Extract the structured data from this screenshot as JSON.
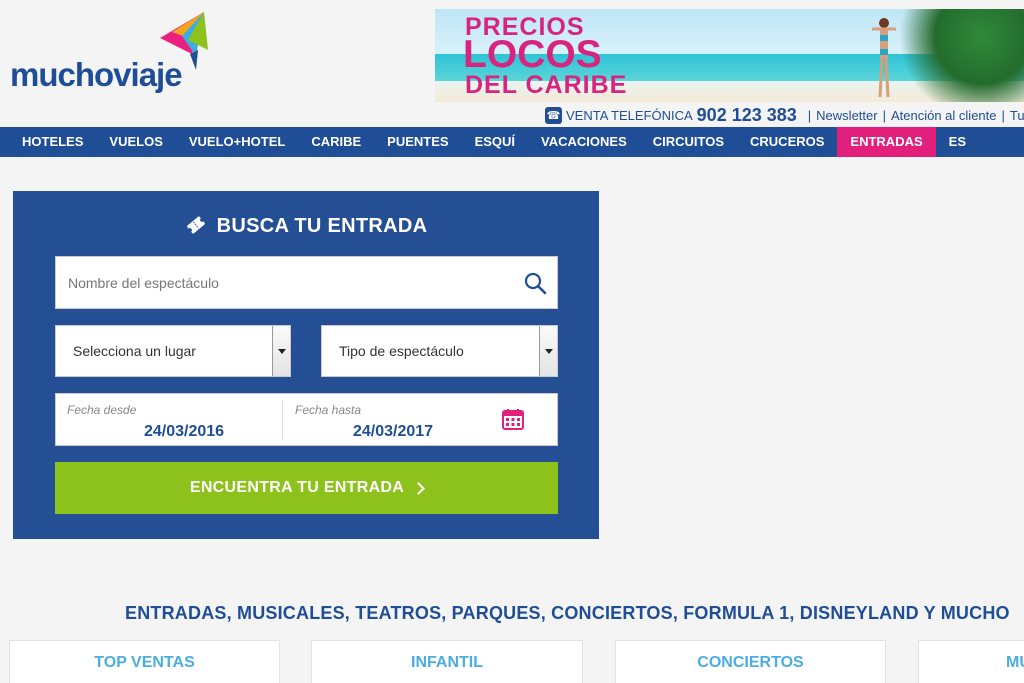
{
  "header": {
    "logo_text": "muchoviaje",
    "banner": {
      "line1": "PRECIOS",
      "line2": "LOCOS",
      "line3": "DEL CARIBE"
    },
    "contact": {
      "phone_icon": "phone-icon",
      "label": "VENTA TELEFÓNICA",
      "number": "902 123 383",
      "separator": "|",
      "links": [
        "Newsletter",
        "Atención al cliente",
        "Tus r"
      ]
    }
  },
  "nav": {
    "items": [
      {
        "label": "HOTELES"
      },
      {
        "label": "VUELOS"
      },
      {
        "label": "VUELO+HOTEL"
      },
      {
        "label": "CARIBE"
      },
      {
        "label": "PUENTES"
      },
      {
        "label": "ESQUÍ"
      },
      {
        "label": "VACACIONES"
      },
      {
        "label": "CIRCUITOS"
      },
      {
        "label": "CRUCEROS"
      },
      {
        "label": "ENTRADAS",
        "active": true
      },
      {
        "label": "ES"
      }
    ]
  },
  "search": {
    "title": "BUSCA TU ENTRADA",
    "show_placeholder": "Nombre del espectáculo",
    "place_select": "Selecciona un lugar",
    "type_select": "Tipo de espectáculo",
    "date_from_label": "Fecha desde",
    "date_from_value": "24/03/2016",
    "date_to_label": "Fecha hasta",
    "date_to_value": "24/03/2017",
    "submit_label": "ENCUENTRA TU ENTRADA"
  },
  "colors": {
    "brand_blue": "#1f4e96",
    "panel_blue": "#254f95",
    "active_pink": "#e2207c",
    "button_green": "#8cc21b",
    "card_title_blue": "#4aaee0"
  },
  "section": {
    "heading": "ENTRADAS, MUSICALES, TEATROS, PARQUES, CONCIERTOS, FORMULA 1, DISNEYLAND Y MUCHO"
  },
  "cards": [
    {
      "label": "TOP VENTAS"
    },
    {
      "label": "INFANTIL"
    },
    {
      "label": "CONCIERTOS"
    },
    {
      "label": "MU"
    }
  ]
}
